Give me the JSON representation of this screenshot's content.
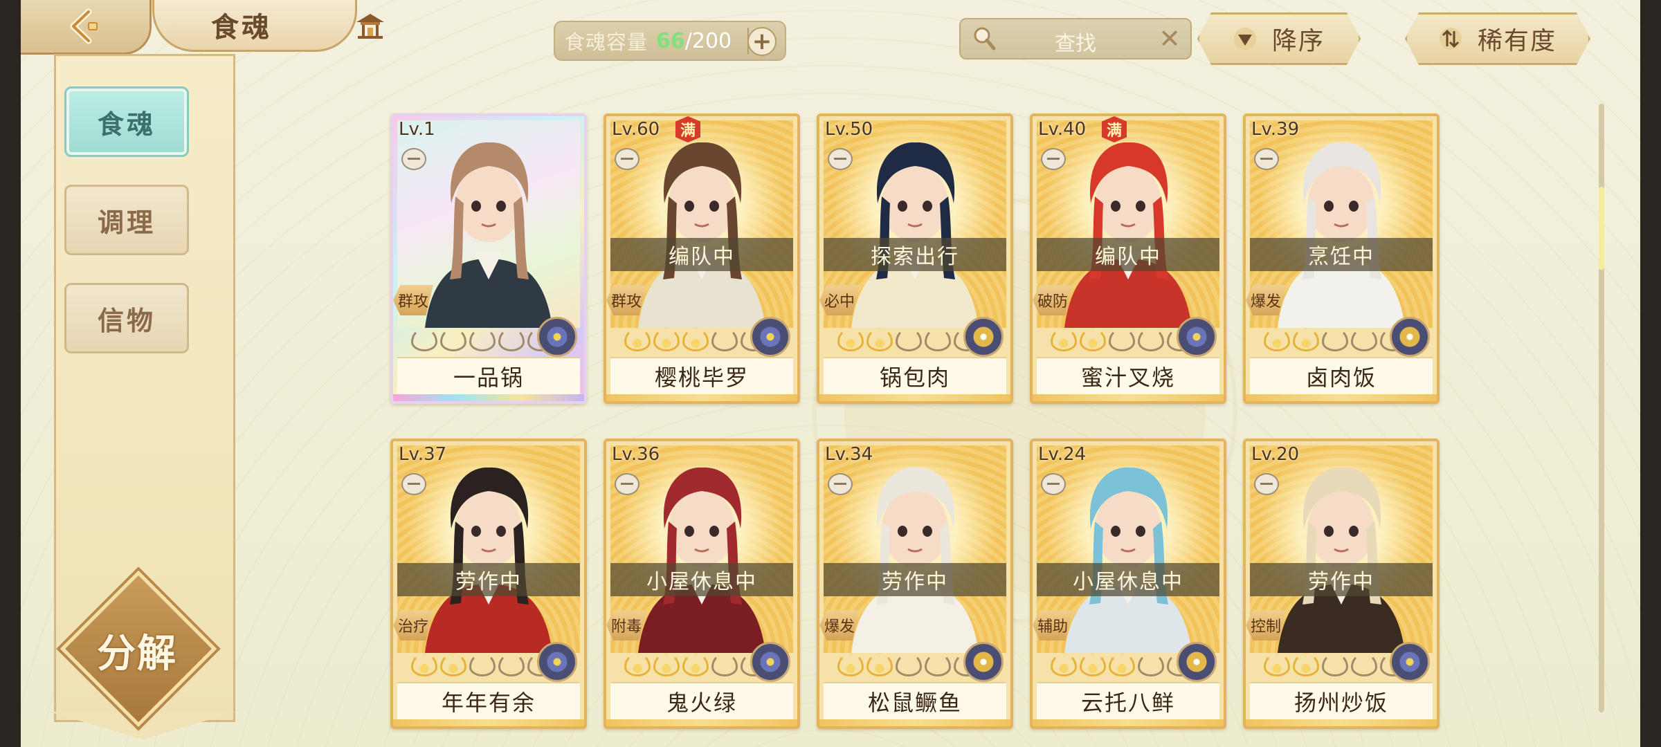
{
  "header": {
    "title": "食魂",
    "capacity_label": "食魂容量",
    "capacity_current": "66",
    "capacity_sep": "/",
    "capacity_max": "200",
    "search_placeholder": "查找",
    "sort_order_label": "降序",
    "sort_by_label": "稀有度"
  },
  "sidebar": {
    "tabs": [
      {
        "label": "食魂",
        "active": true
      },
      {
        "label": "调理",
        "active": false
      },
      {
        "label": "信物",
        "active": false
      }
    ],
    "decompose_label": "分解"
  },
  "colors": {
    "accent_green": "#7ee07e",
    "card_gold": "#e3b35e",
    "active_tab": "#9edad1"
  },
  "cards": [
    {
      "level": "Lv.1",
      "name": "一品锅",
      "status": "",
      "role": "群攻",
      "stars": 0,
      "full": false,
      "rainbow": true,
      "element": "blue",
      "hair": "#b58a6a",
      "cloth": "#2f3a44"
    },
    {
      "level": "Lv.60",
      "name": "樱桃毕罗",
      "status": "编队中",
      "role": "群攻",
      "stars": 3,
      "full": true,
      "full_label": "满",
      "rainbow": false,
      "element": "blue",
      "hair": "#6a4630",
      "cloth": "#e8e2d0"
    },
    {
      "level": "Lv.50",
      "name": "锅包肉",
      "status": "探索出行",
      "role": "必中",
      "stars": 2,
      "full": false,
      "rainbow": false,
      "element": "gold",
      "hair": "#1f2a44",
      "cloth": "#f2e8cc"
    },
    {
      "level": "Lv.40",
      "name": "蜜汁叉烧",
      "status": "编队中",
      "role": "破防",
      "stars": 2,
      "full": true,
      "full_label": "满",
      "rainbow": false,
      "element": "blue",
      "hair": "#d8382a",
      "cloth": "#c8342a"
    },
    {
      "level": "Lv.39",
      "name": "卤肉饭",
      "status": "烹饪中",
      "role": "爆发",
      "stars": 2,
      "full": false,
      "rainbow": false,
      "element": "gold",
      "hair": "#e8e4df",
      "cloth": "#f3f1ec"
    },
    {
      "level": "Lv.37",
      "name": "年年有余",
      "status": "劳作中",
      "role": "治疗",
      "stars": 2,
      "full": false,
      "rainbow": false,
      "element": "blue",
      "hair": "#2a2220",
      "cloth": "#b82a24"
    },
    {
      "level": "Lv.36",
      "name": "鬼火绿",
      "status": "小屋休息中",
      "role": "附毒",
      "stars": 3,
      "full": false,
      "rainbow": false,
      "element": "blue",
      "hair": "#a02a2e",
      "cloth": "#7a1e22"
    },
    {
      "level": "Lv.34",
      "name": "松鼠鳜鱼",
      "status": "劳作中",
      "role": "爆发",
      "stars": 2,
      "full": false,
      "rainbow": false,
      "element": "gold",
      "hair": "#ece7dc",
      "cloth": "#f4f0e6"
    },
    {
      "level": "Lv.24",
      "name": "云托八鲜",
      "status": "小屋休息中",
      "role": "辅助",
      "stars": 3,
      "full": false,
      "rainbow": false,
      "element": "gold",
      "hair": "#7cc2d6",
      "cloth": "#dfe6ea"
    },
    {
      "level": "Lv.20",
      "name": "扬州炒饭",
      "status": "劳作中",
      "role": "控制",
      "stars": 2,
      "full": false,
      "rainbow": false,
      "element": "blue",
      "hair": "#e8d9b8",
      "cloth": "#3a2c22"
    }
  ]
}
